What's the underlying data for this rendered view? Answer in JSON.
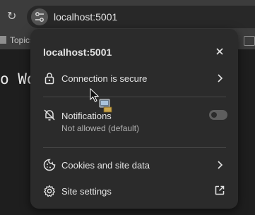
{
  "browser": {
    "url": "localhost:5001",
    "bookmark_folder": "Topics",
    "page_text": "o Wor"
  },
  "popup": {
    "title": "localhost:5001",
    "connection": {
      "label": "Connection is secure"
    },
    "notifications": {
      "label": "Notifications",
      "sub": "Not allowed (default)",
      "enabled": false
    },
    "cookies": {
      "label": "Cookies and site data"
    },
    "site_settings": {
      "label": "Site settings"
    }
  },
  "colors": {
    "popup_bg": "#2b2b2b",
    "toolbar": "#3c3c3c",
    "page_bg": "#1e1e1e"
  }
}
